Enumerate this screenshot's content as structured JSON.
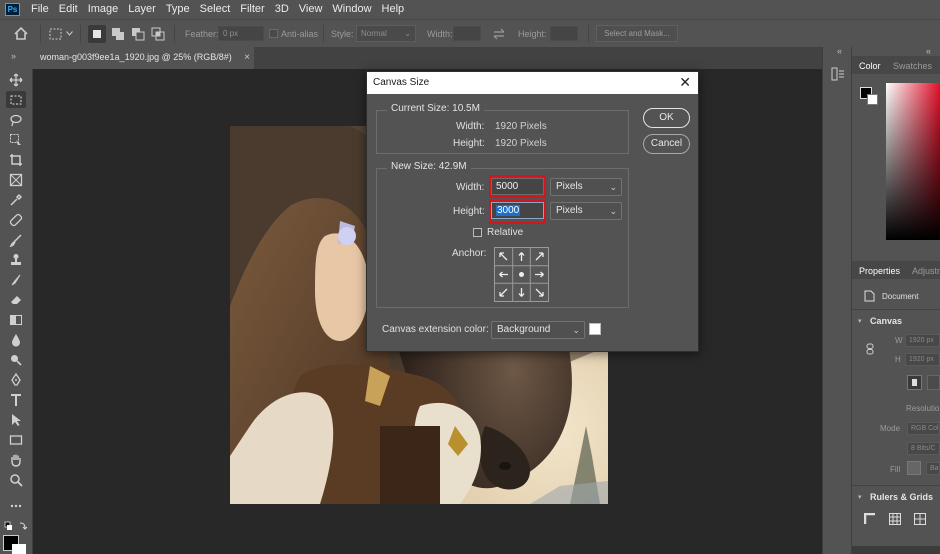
{
  "app": {
    "logo_text": "Ps"
  },
  "menu": [
    "File",
    "Edit",
    "Image",
    "Layer",
    "Type",
    "Select",
    "Filter",
    "3D",
    "View",
    "Window",
    "Help"
  ],
  "options_bar": {
    "feather_label": "Feather:",
    "feather_value": "0 px",
    "antialias_label": "Anti-alias",
    "style_label": "Style:",
    "style_value": "Normal",
    "width_label": "Width:",
    "height_label": "Height:",
    "select_mask_label": "Select and Mask..."
  },
  "document_tab": {
    "title": "woman-g003f9ee1a_1920.jpg @ 25% (RGB/8#)",
    "close": "×"
  },
  "dialog": {
    "title": "Canvas Size",
    "close": "✕",
    "current_size": {
      "heading": "Current Size: 10.5M",
      "width_label": "Width:",
      "width_value": "1920 Pixels",
      "height_label": "Height:",
      "height_value": "1920 Pixels"
    },
    "new_size": {
      "heading": "New Size: 42.9M",
      "width_label": "Width:",
      "width_value": "5000",
      "width_unit": "Pixels",
      "height_label": "Height:",
      "height_value": "3000",
      "height_unit": "Pixels",
      "relative_label": "Relative",
      "relative_checked": false,
      "anchor_label": "Anchor:"
    },
    "extension_color_label": "Canvas extension color:",
    "extension_color_value": "Background",
    "extension_swatch_color": "#ffffff",
    "ok_label": "OK",
    "cancel_label": "Cancel",
    "highlight_color": "#d4151b"
  },
  "panels": {
    "color_tab": "Color",
    "swatches_tab": "Swatches",
    "properties_tab": "Properties",
    "adjustments_tab": "Adjustn",
    "document_label": "Document",
    "canvas_section": "Canvas",
    "w_label": "W",
    "w_value": "1920 px",
    "h_label": "H",
    "h_value": "1920 px",
    "resolution_label": "Resolutio",
    "mode_label": "Mode",
    "mode_value": "RGB Col",
    "bits_value": "8 Bits/C",
    "fill_label": "Fill",
    "fill_value": "Ba",
    "rulers_section": "Rulers & Grids"
  }
}
